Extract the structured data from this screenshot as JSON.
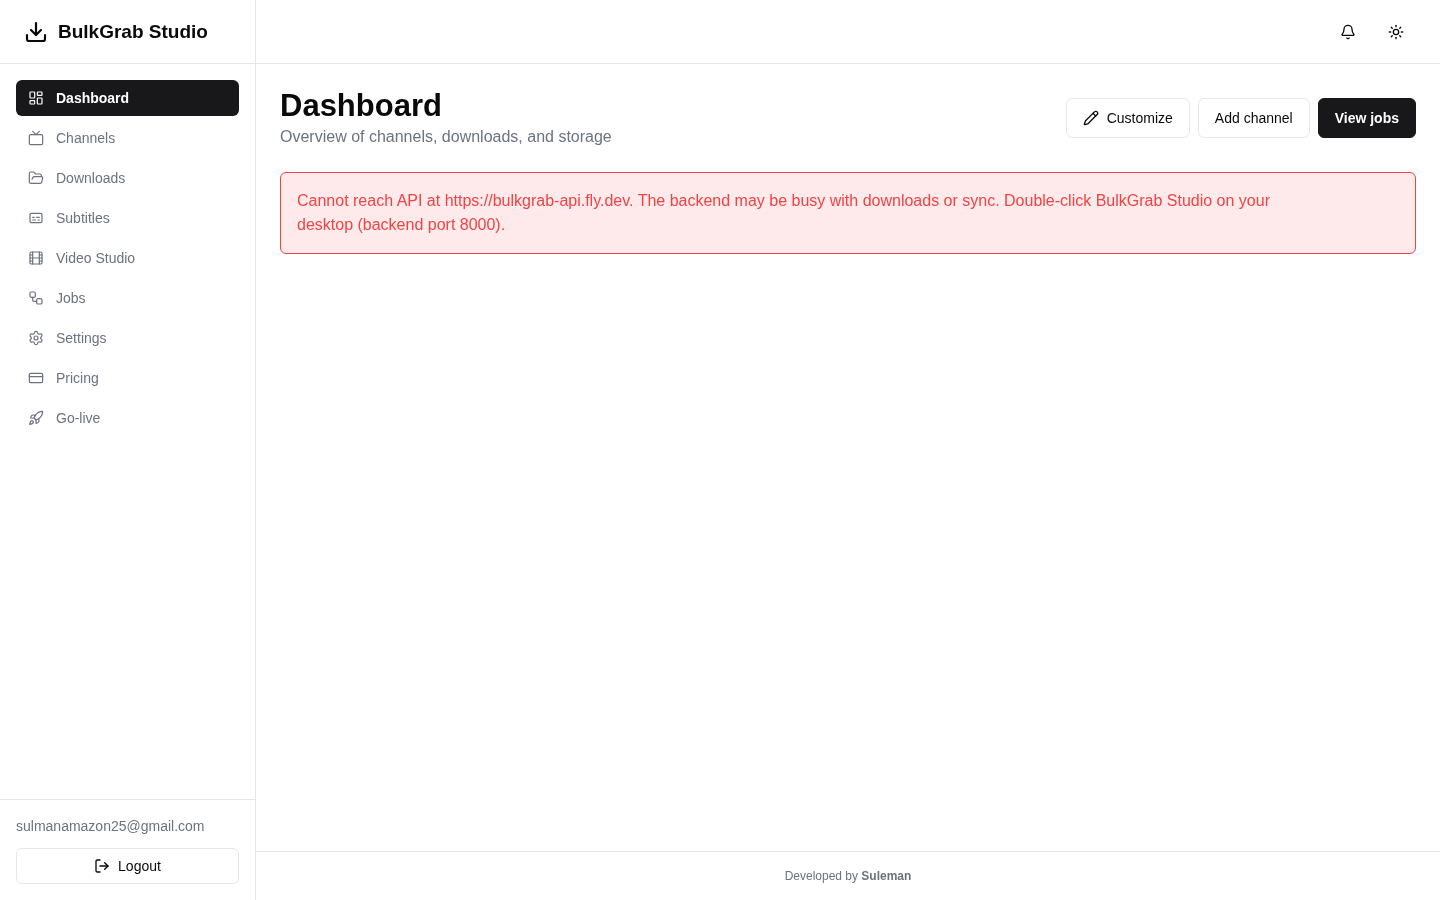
{
  "app": {
    "title": "BulkGrab Studio"
  },
  "sidebar": {
    "items": [
      {
        "label": "Dashboard",
        "selected": true
      },
      {
        "label": "Channels",
        "selected": false
      },
      {
        "label": "Downloads",
        "selected": false
      },
      {
        "label": "Subtitles",
        "selected": false
      },
      {
        "label": "Video Studio",
        "selected": false
      },
      {
        "label": "Jobs",
        "selected": false
      },
      {
        "label": "Settings",
        "selected": false
      },
      {
        "label": "Pricing",
        "selected": false
      },
      {
        "label": "Go-live",
        "selected": false
      }
    ],
    "user_email": "sulmanamazon25@gmail.com",
    "logout_button": "Logout"
  },
  "page": {
    "title": "Dashboard",
    "subtitle": "Overview of channels, downloads, and storage",
    "buttons": [
      {
        "label": "Customize",
        "kind": "outline"
      },
      {
        "label": "Add channel",
        "kind": "outline"
      },
      {
        "label": "View jobs",
        "kind": "primary"
      }
    ]
  },
  "alert": {
    "message": "Cannot reach API at https://bulkgrab-api.fly.dev. The backend may be busy with downloads or sync. Double-click BulkGrab Studio on your desktop (backend port 8000)."
  },
  "footer": {
    "text": "Developed by **Suleman**"
  }
}
